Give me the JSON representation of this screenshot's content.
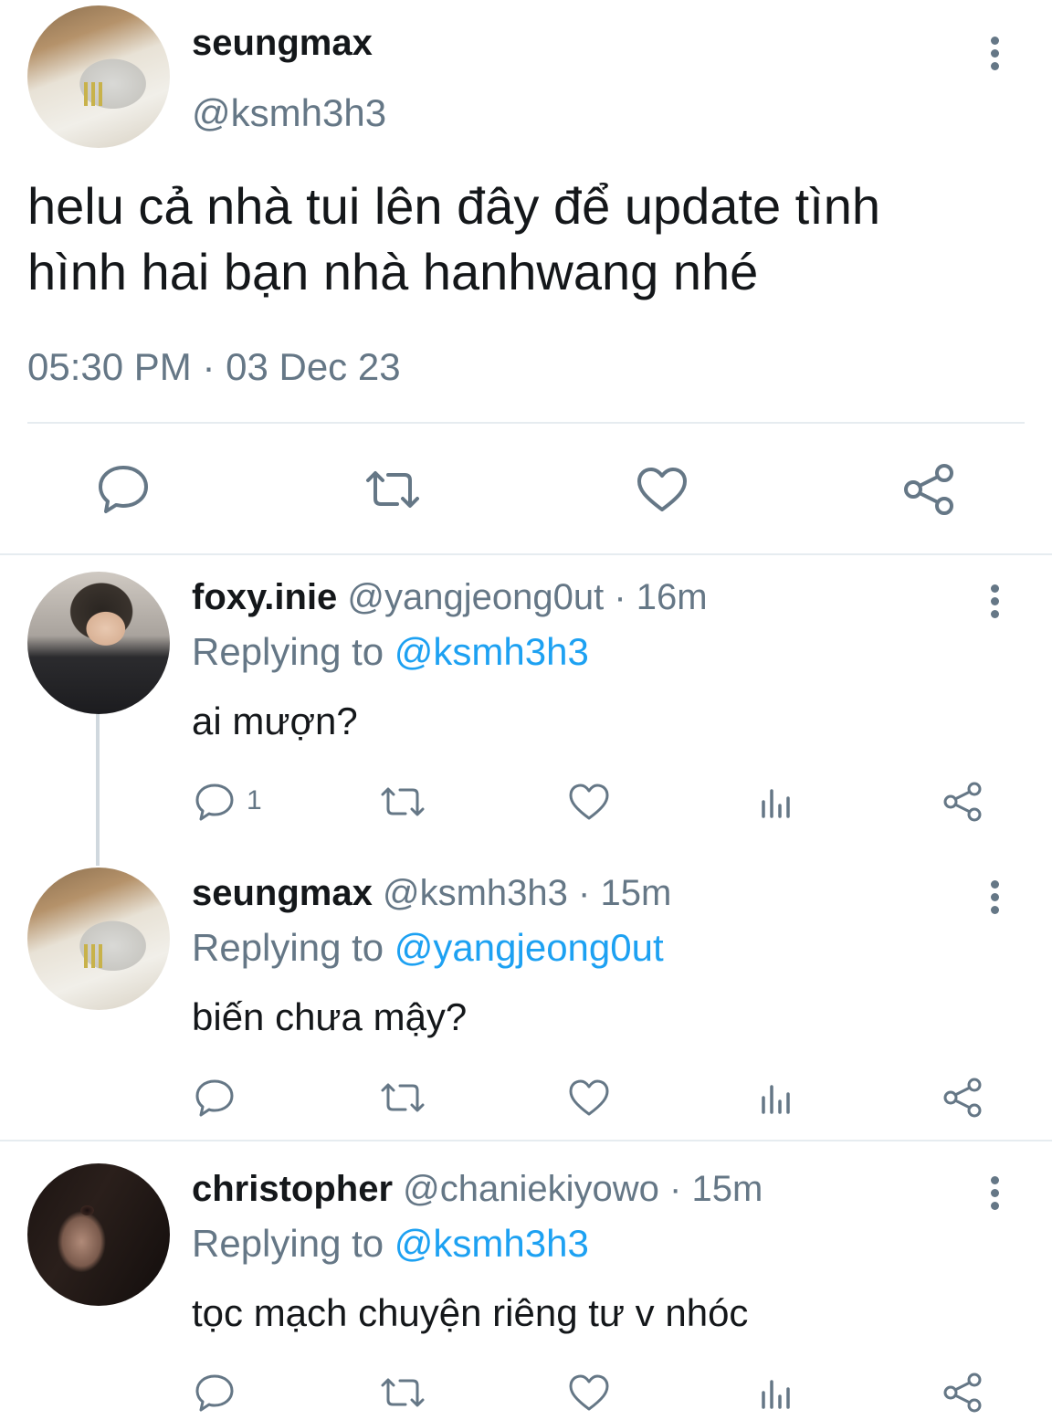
{
  "main_tweet": {
    "display_name": "seungmax",
    "handle": "@ksmh3h3",
    "text_line1": "helu cả nhà tui lên đây để update tình",
    "text_line2": "hình hai bạn nhà hanhwang nhé",
    "timestamp": "05:30 PM · 03 Dec 23",
    "actions": {
      "reply_icon": "speech-bubble-icon",
      "retweet_icon": "retweet-icon",
      "like_icon": "heart-icon",
      "share_icon": "share-icon"
    }
  },
  "replies": [
    {
      "display_name": "foxy.inie",
      "handle": "@yangjeong0ut",
      "time": "16m",
      "replying_prefix": "Replying to ",
      "replying_to": "@ksmh3h3",
      "text": "ai mượn?",
      "reply_count": "1"
    },
    {
      "display_name": "seungmax",
      "handle": "@ksmh3h3",
      "time": "15m",
      "replying_prefix": "Replying to ",
      "replying_to": "@yangjeong0ut",
      "text": "biến chưa mậy?",
      "reply_count": ""
    },
    {
      "display_name": "christopher",
      "handle": "@chaniekiyowo",
      "time": "15m",
      "replying_prefix": "Replying to ",
      "replying_to": "@ksmh3h3",
      "text": "tọc mạch chuyện riêng tư v nhóc",
      "reply_count": ""
    }
  ],
  "separator": " · ",
  "colors": {
    "text": "#14171a",
    "muted": "#657786",
    "link": "#1da1f2",
    "divider": "#e6ecf0"
  }
}
